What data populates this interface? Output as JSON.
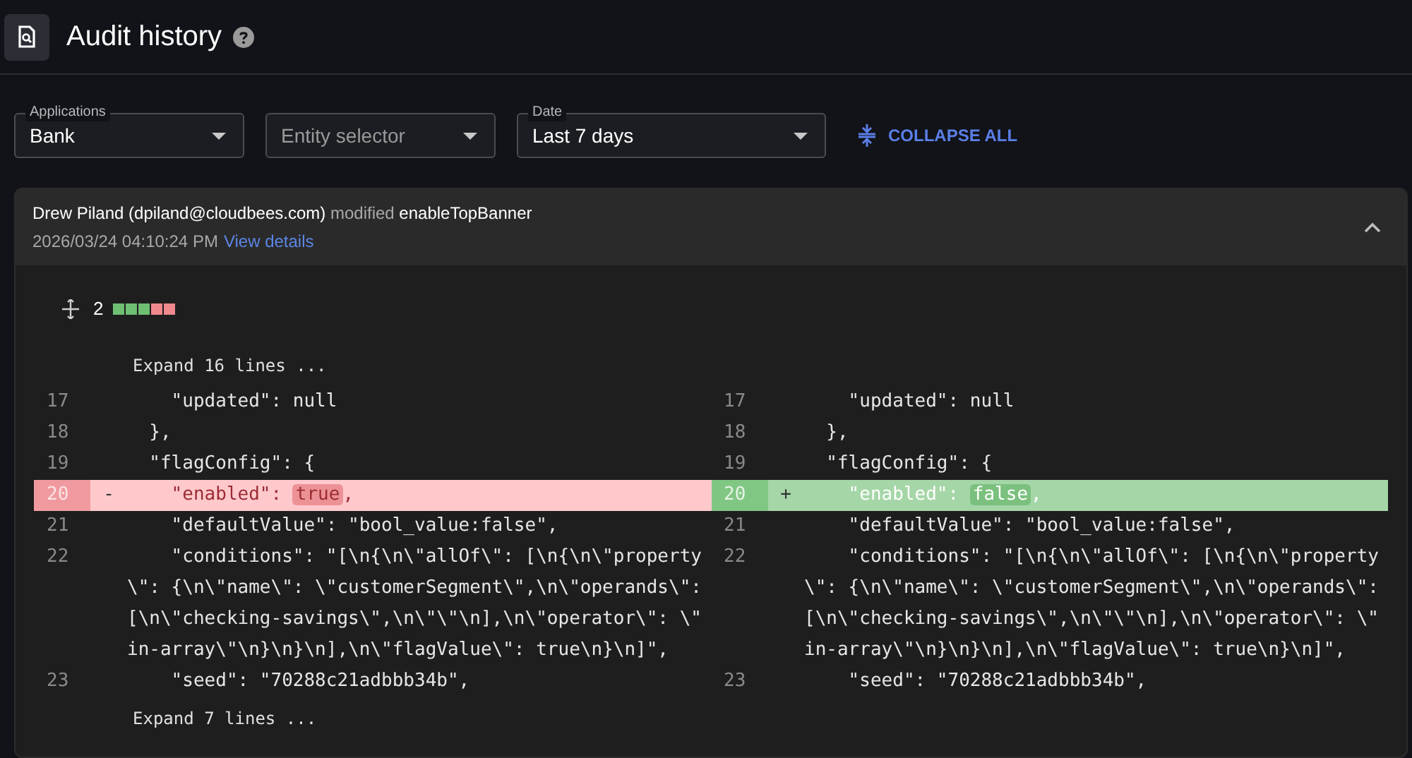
{
  "header": {
    "title": "Audit history"
  },
  "filters": [
    {
      "label": "Applications",
      "value": "Bank"
    },
    {
      "placeholder": "Entity selector"
    },
    {
      "label": "Date",
      "value": "Last 7 days"
    }
  ],
  "collapse_button": "COLLAPSE ALL",
  "entries": [
    {
      "expanded": true,
      "user": "Drew Piland (dpiland@cloudbees.com)",
      "action": "modified",
      "target": "enableTopBanner",
      "timestamp": "2026/03/24 04:10:24 PM",
      "link": "View details",
      "change_count": "2",
      "change_blocks": [
        {
          "kind": "added"
        },
        {
          "kind": "added"
        },
        {
          "kind": "added"
        },
        {
          "kind": "removed"
        },
        {
          "kind": "removed"
        }
      ],
      "diff": [
        {
          "kind": "expand",
          "text": "Expand 16 lines ..."
        },
        {
          "kind": "line",
          "left": {
            "kind": "context",
            "number": "17",
            "lines": [
              "    \"updated\": null"
            ]
          },
          "right": {
            "kind": "context",
            "number": "17",
            "lines": [
              "    \"updated\": null"
            ]
          }
        },
        {
          "kind": "line",
          "left": {
            "kind": "context",
            "number": "18",
            "lines": [
              "  },"
            ]
          },
          "right": {
            "kind": "context",
            "number": "18",
            "lines": [
              "  },"
            ]
          }
        },
        {
          "kind": "line",
          "left": {
            "kind": "context",
            "number": "19",
            "lines": [
              "  \"flagConfig\": {"
            ]
          },
          "right": {
            "kind": "context",
            "number": "19",
            "lines": [
              "  \"flagConfig\": {"
            ]
          }
        },
        {
          "kind": "line",
          "left": {
            "kind": "removed",
            "number": "20",
            "marker": "-",
            "segments": [
              {
                "text": "    \"enabled\": ",
                "changed": false
              },
              {
                "text": "true",
                "changed": true
              },
              {
                "text": ",",
                "changed": false
              }
            ]
          },
          "right": {
            "kind": "added",
            "number": "20",
            "marker": "+",
            "segments": [
              {
                "text": "    \"enabled\": ",
                "changed": false
              },
              {
                "text": "false",
                "changed": true
              },
              {
                "text": ",",
                "changed": false
              }
            ]
          }
        },
        {
          "kind": "line",
          "left": {
            "kind": "context",
            "number": "21",
            "lines": [
              "    \"defaultValue\": \"bool_value:false\","
            ]
          },
          "right": {
            "kind": "context",
            "number": "21",
            "lines": [
              "    \"defaultValue\": \"bool_value:false\","
            ]
          }
        },
        {
          "kind": "line",
          "left": {
            "kind": "context",
            "number": "22",
            "lines": [
              "    \"conditions\": \"[\\n{\\n\\\"allOf\\\": [\\n{\\n\\\"property",
              "\\\": {\\n\\\"name\\\": \\\"customerSegment\\\",\\n\\\"operands\\\":",
              "[\\n\\\"checking-savings\\\",\\n\\\"\\\"\\n],\\n\\\"operator\\\": \\\"",
              "in-array\\\"\\n}\\n}\\n],\\n\\\"flagValue\\\": true\\n}\\n]\","
            ]
          },
          "right": {
            "kind": "context",
            "number": "22",
            "lines": [
              "    \"conditions\": \"[\\n{\\n\\\"allOf\\\": [\\n{\\n\\\"property",
              "\\\": {\\n\\\"name\\\": \\\"customerSegment\\\",\\n\\\"operands\\\":",
              "[\\n\\\"checking-savings\\\",\\n\\\"\\\"\\n],\\n\\\"operator\\\": \\\"",
              "in-array\\\"\\n}\\n}\\n],\\n\\\"flagValue\\\": true\\n}\\n]\","
            ]
          }
        },
        {
          "kind": "line",
          "left": {
            "kind": "context",
            "number": "23",
            "lines": [
              "    \"seed\": \"70288c21adbbb34b\","
            ]
          },
          "right": {
            "kind": "context",
            "number": "23",
            "lines": [
              "    \"seed\": \"70288c21adbbb34b\","
            ]
          }
        },
        {
          "kind": "expand",
          "text": "Expand 7 lines ..."
        }
      ]
    }
  ]
}
